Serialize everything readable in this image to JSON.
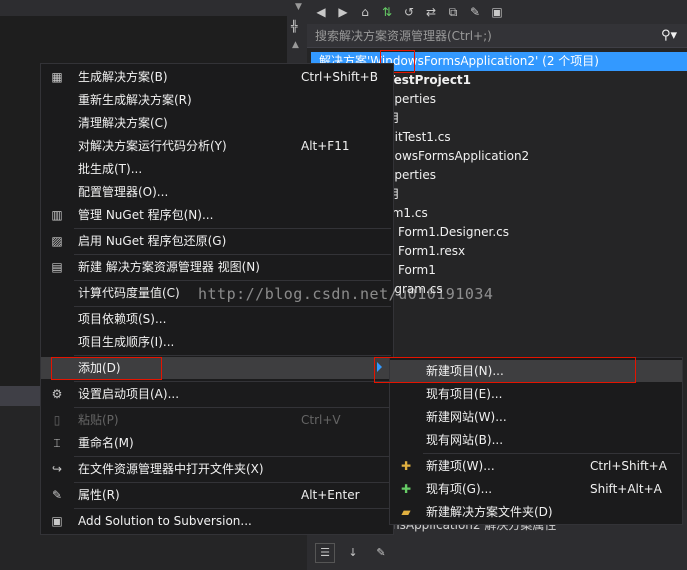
{
  "editor": {
    "scroll_arrow": "▲"
  },
  "solution_explorer": {
    "toolbar_icons": [
      "back-icon",
      "forward-icon",
      "home-icon",
      "sync-icon",
      "history-icon",
      "refresh-icon",
      "collapse-icon",
      "properties-icon",
      "preview-icon"
    ],
    "search_placeholder": "搜索解决方案资源管理器(Ctrl+;)",
    "tree": [
      "解决方案'WindowsFormsApplication2' (2 个项目)",
      "TestProject1",
      "operties",
      "用",
      "nitTest1.cs",
      "dowsFormsApplication2",
      "operties",
      "用",
      "rm1.cs",
      "Form1.Designer.cs",
      "Form1.resx",
      "Form1",
      "ogram.cs"
    ],
    "bottom_label": "nsApplication2 解决方案属性"
  },
  "context_menu": {
    "items": [
      {
        "label": "生成解决方案(B)",
        "shortcut": "Ctrl+Shift+B",
        "icon": "build-icon"
      },
      {
        "label": "重新生成解决方案(R)",
        "shortcut": "",
        "icon": ""
      },
      {
        "label": "清理解决方案(C)",
        "shortcut": "",
        "icon": ""
      },
      {
        "label": "对解决方案运行代码分析(Y)",
        "shortcut": "Alt+F11",
        "icon": ""
      },
      {
        "label": "批生成(T)...",
        "shortcut": "",
        "icon": ""
      },
      {
        "label": "配置管理器(O)...",
        "shortcut": "",
        "icon": ""
      },
      {
        "label": "管理 NuGet 程序包(N)...",
        "shortcut": "",
        "icon": "nuget-icon"
      },
      {
        "label": "启用 NuGet 程序包还原(G)",
        "shortcut": "",
        "icon": "nuget-restore-icon"
      },
      {
        "label": "新建 解决方案资源管理器 视图(N)",
        "shortcut": "",
        "icon": "new-view-icon"
      },
      {
        "label": "计算代码度量值(C)",
        "shortcut": "",
        "icon": ""
      },
      {
        "label": "项目依赖项(S)...",
        "shortcut": "",
        "icon": ""
      },
      {
        "label": "项目生成顺序(I)...",
        "shortcut": "",
        "icon": ""
      },
      {
        "label": "添加(D)",
        "shortcut": "",
        "icon": ""
      },
      {
        "label": "设置启动项目(A)...",
        "shortcut": "",
        "icon": "gear-icon"
      },
      {
        "label": "粘贴(P)",
        "shortcut": "Ctrl+V",
        "icon": "paste-icon"
      },
      {
        "label": "重命名(M)",
        "shortcut": "",
        "icon": "rename-icon"
      },
      {
        "label": "在文件资源管理器中打开文件夹(X)",
        "shortcut": "",
        "icon": "refresh-arrow-icon"
      },
      {
        "label": "属性(R)",
        "shortcut": "Alt+Enter",
        "icon": "wrench-icon"
      },
      {
        "label": "Add Solution to Subversion...",
        "shortcut": "",
        "icon": "subversion-icon"
      }
    ]
  },
  "submenu": {
    "items": [
      {
        "label": "新建项目(N)...",
        "shortcut": "",
        "icon": ""
      },
      {
        "label": "现有项目(E)...",
        "shortcut": "",
        "icon": ""
      },
      {
        "label": "新建网站(W)...",
        "shortcut": "",
        "icon": ""
      },
      {
        "label": "现有网站(B)...",
        "shortcut": "",
        "icon": ""
      },
      {
        "label": "新建项(W)...",
        "shortcut": "Ctrl+Shift+A",
        "icon": "new-item-icon"
      },
      {
        "label": "现有项(G)...",
        "shortcut": "Shift+Alt+A",
        "icon": "existing-item-icon"
      },
      {
        "label": "新建解决方案文件夹(D)",
        "shortcut": "",
        "icon": "new-folder-icon"
      }
    ]
  },
  "watermark": "http://blog.csdn.net/u010191034",
  "colors": {
    "selection": "#3399ff",
    "highlight_box": "#e51400",
    "menu_bg": "#1b1b1c"
  }
}
